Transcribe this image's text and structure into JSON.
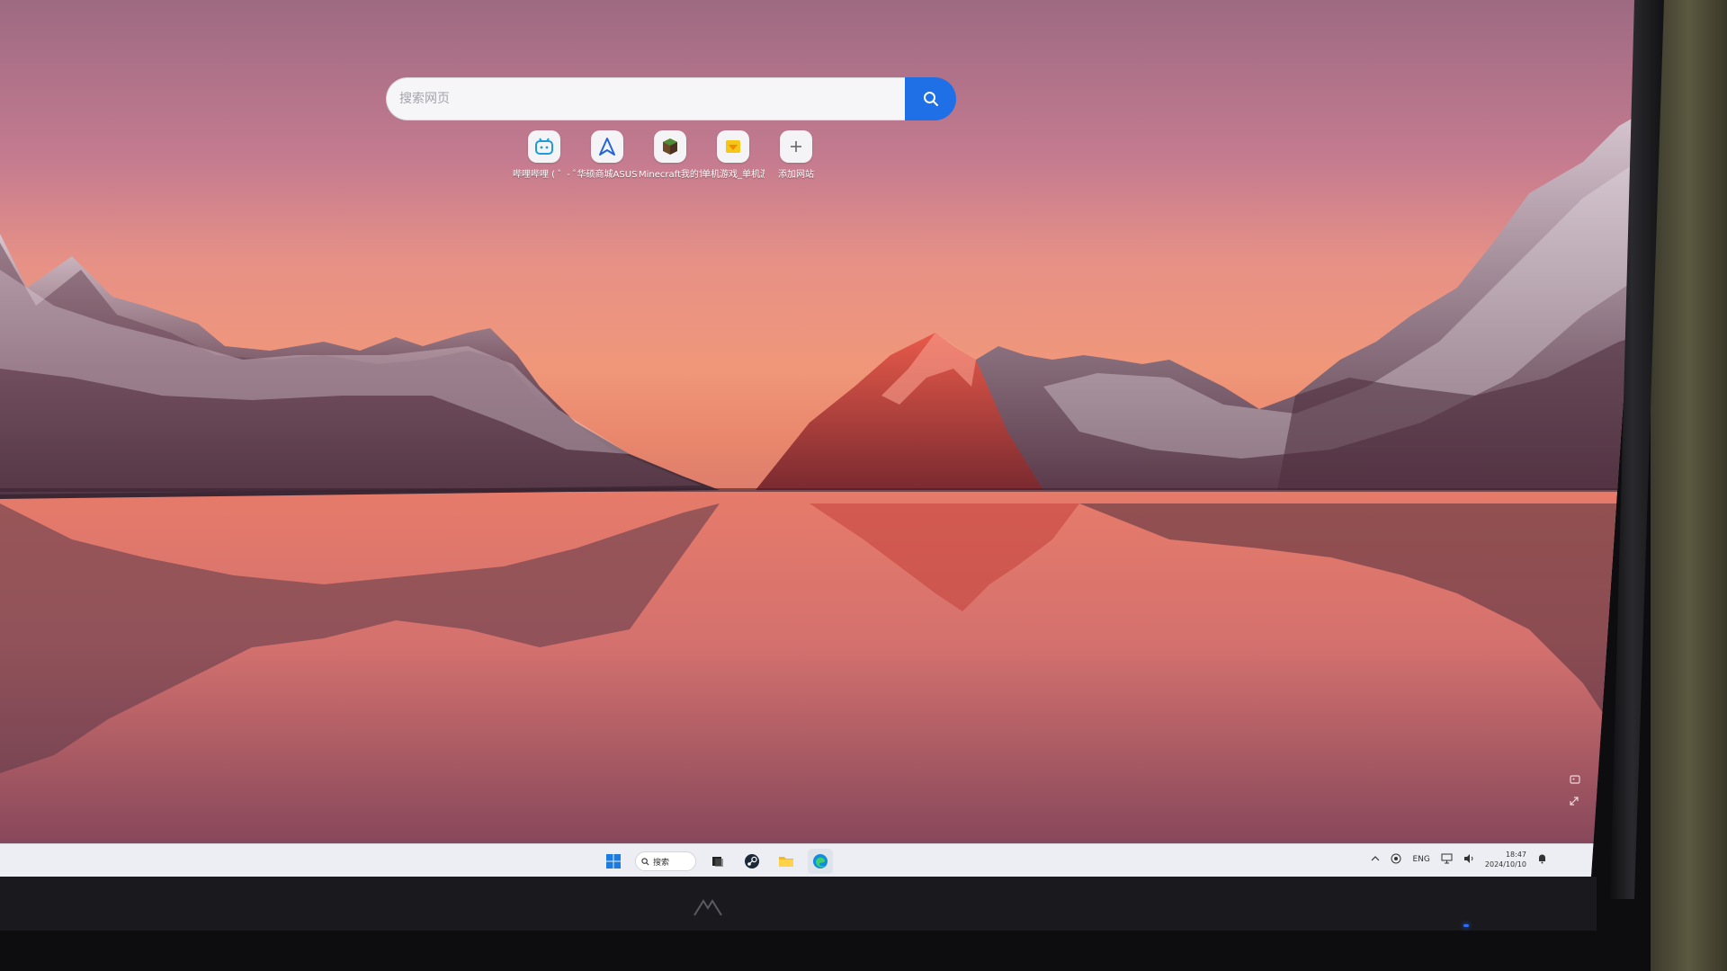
{
  "search": {
    "placeholder": "搜索网页"
  },
  "shortcuts": [
    {
      "label": "哔哩哔哩 ( ゜- ゜)",
      "icon": "bilibili-icon"
    },
    {
      "label": "华硕商城ASUS",
      "icon": "asus-icon"
    },
    {
      "label": "Minecraft我的世界",
      "icon": "minecraft-icon"
    },
    {
      "label": "单机游戏_单机游戏",
      "icon": "game-folder-icon"
    },
    {
      "label": "添加网站",
      "icon": "plus-icon"
    }
  ],
  "taskbar": {
    "search_label": "搜索",
    "apps": [
      "windows-start-icon",
      "search",
      "task-view-icon",
      "steam-icon",
      "file-explorer-icon",
      "edge-icon"
    ],
    "tray": {
      "language": "ENG",
      "time": "18:47",
      "date": "2024/10/10"
    }
  },
  "colors": {
    "search_button": "#1f6fe6",
    "taskbar_bg": "#edeef3",
    "sky_top": "#9d6a82",
    "horizon": "#f0977a"
  }
}
